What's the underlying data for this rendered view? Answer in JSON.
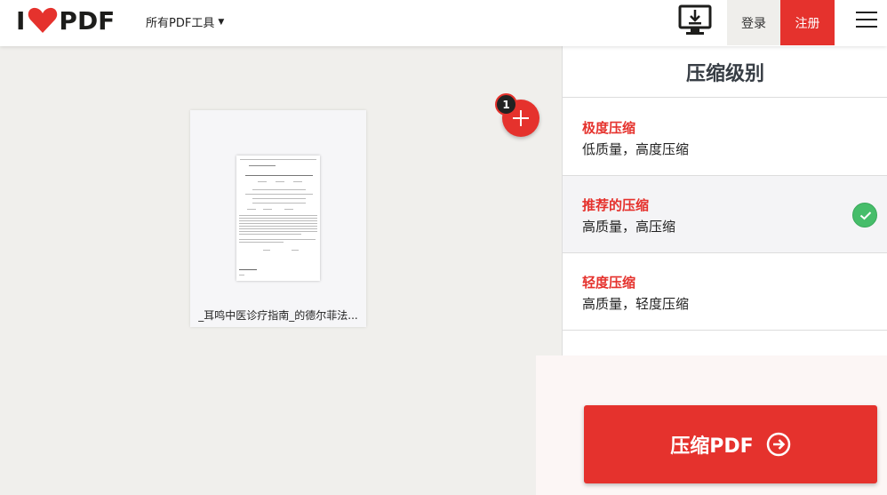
{
  "header": {
    "logo_i": "I",
    "logo_pdf": "PDF",
    "tools_menu_label": "所有PDF工具",
    "login_label": "登录",
    "register_label": "注册",
    "icons": [
      "heart-logo-icon",
      "caret-down-icon",
      "desktop-download-icon",
      "hamburger-menu-icon"
    ]
  },
  "workspace": {
    "file_count": "1",
    "file_name": "_耳鸣中医诊疗指南_的德尔菲法..."
  },
  "sidebar": {
    "title": "压缩级别",
    "options": [
      {
        "title": "极度压缩",
        "desc": "低质量，高度压缩",
        "selected": false
      },
      {
        "title": "推荐的压缩",
        "desc": "高质量，高压缩",
        "selected": true
      },
      {
        "title": "轻度压缩",
        "desc": "高质量，轻度压缩",
        "selected": false
      }
    ],
    "action_label": "压缩PDF"
  },
  "colors": {
    "brand_red": "#e5322d",
    "check_green": "#46bd6a"
  }
}
